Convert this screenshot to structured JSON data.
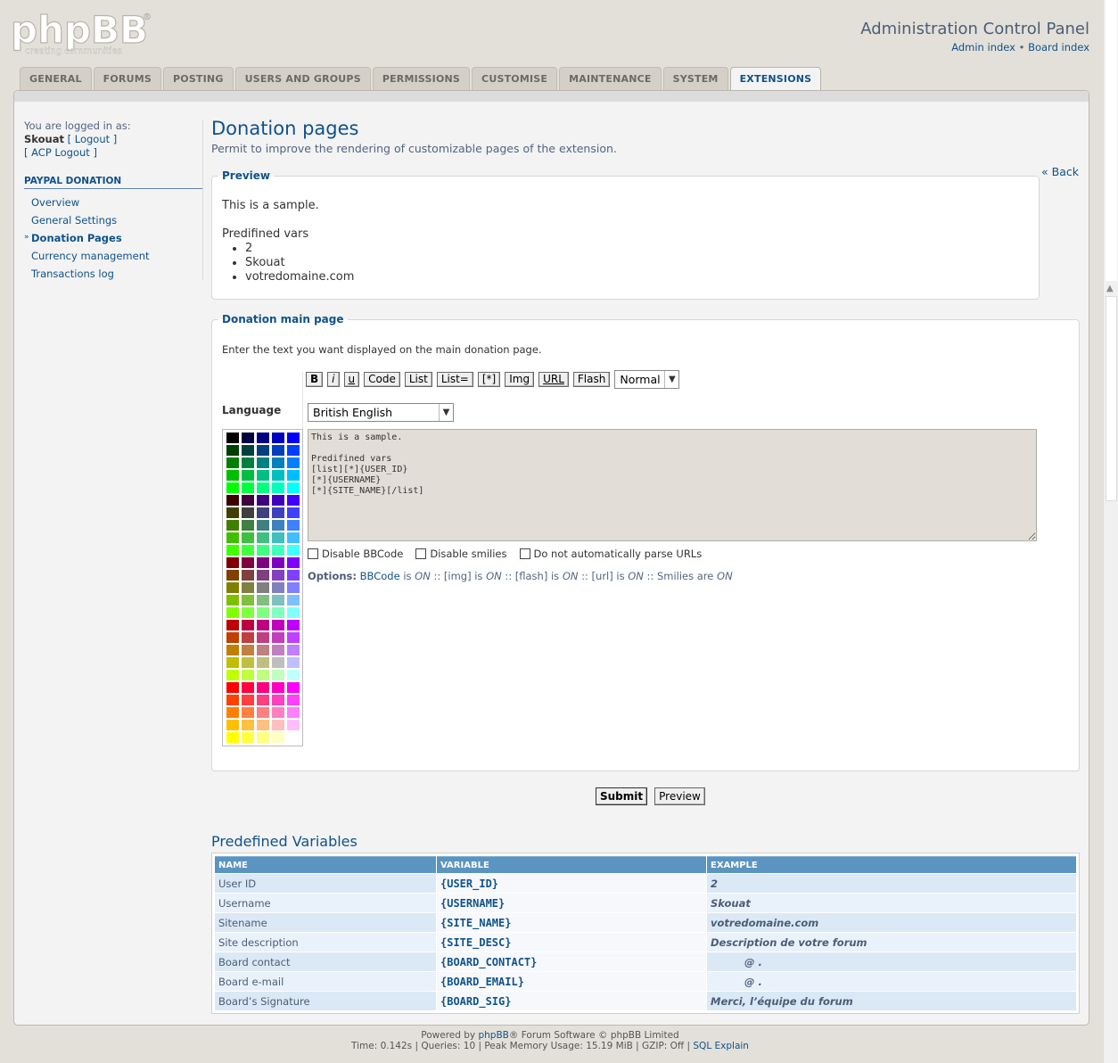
{
  "header": {
    "logo_text": "phpBB",
    "logo_tagline": "creating communities",
    "title": "Administration Control Panel",
    "admin_index": "Admin index",
    "separator": "•",
    "board_index": "Board index"
  },
  "tabs": [
    {
      "label": "GENERAL"
    },
    {
      "label": "FORUMS"
    },
    {
      "label": "POSTING"
    },
    {
      "label": "USERS AND GROUPS"
    },
    {
      "label": "PERMISSIONS"
    },
    {
      "label": "CUSTOMISE"
    },
    {
      "label": "MAINTENANCE"
    },
    {
      "label": "SYSTEM"
    },
    {
      "label": "EXTENSIONS",
      "active": true
    }
  ],
  "sidebar": {
    "logged_in_as": "You are logged in as:",
    "username": "Skouat",
    "logout": "[ Logout ]",
    "acp_logout": "[ ACP Logout ]",
    "section": "PAYPAL DONATION",
    "items": [
      {
        "label": "Overview"
      },
      {
        "label": "General Settings"
      },
      {
        "label": "Donation Pages",
        "active": true
      },
      {
        "label": "Currency management"
      },
      {
        "label": "Transactions log"
      }
    ]
  },
  "page": {
    "title": "Donation pages",
    "description": "Permit to improve the rendering of customizable pages of the extension.",
    "back": "« Back"
  },
  "preview": {
    "legend": "Preview",
    "line1": "This is a sample.",
    "line2": "Predifined vars",
    "items": [
      "2",
      "Skouat",
      "votredomaine.com"
    ]
  },
  "donation_main": {
    "legend": "Donation main page",
    "description": "Enter the text you want displayed on the main donation page.",
    "bbcode_buttons": [
      "B",
      "i",
      "u",
      "Code",
      "List",
      "List=",
      "[*]",
      "Img",
      "URL",
      "Flash"
    ],
    "font_size_selected": "Normal",
    "language_label": "Language",
    "language_selected": "British English",
    "textarea": "This is a sample.\n\nPredifined vars\n[list][*]{USER_ID}\n[*]{USERNAME}\n[*]{SITE_NAME}[/list]",
    "disable_bbcode": "Disable BBCode",
    "disable_smilies": "Disable smilies",
    "no_parse_urls": "Do not automatically parse URLs",
    "options_label": "Options:",
    "opt_bbcode": "BBCode",
    "opt_is": "is",
    "on": "ON",
    "opt_img": "[img]",
    "opt_flash": "[flash]",
    "opt_url": "[url]",
    "opt_smilies": "Smilies are",
    "opt_sep": "::"
  },
  "buttons": {
    "submit": "Submit",
    "preview": "Preview"
  },
  "vars": {
    "title": "Predefined Variables",
    "headers": [
      "NAME",
      "VARIABLE",
      "EXAMPLE"
    ],
    "rows": [
      [
        "User ID",
        "{USER_ID}",
        "2"
      ],
      [
        "Username",
        "{USERNAME}",
        "Skouat"
      ],
      [
        "Sitename",
        "{SITE_NAME}",
        "votredomaine.com"
      ],
      [
        "Site description",
        "{SITE_DESC}",
        "Description de votre forum"
      ],
      [
        "Board contact",
        "{BOARD_CONTACT}",
        "@ ."
      ],
      [
        "Board e-mail",
        "{BOARD_EMAIL}",
        "@ ."
      ],
      [
        "Board’s Signature",
        "{BOARD_SIG}",
        "Merci, l’équipe du forum"
      ]
    ]
  },
  "footer": {
    "powered_prefix": "Powered by",
    "phpbb": "phpBB",
    "powered_suffix": "® Forum Software © phpBB Limited",
    "stats": "Time: 0.142s | Queries: 10 | Peak Memory Usage: 15.19 MiB | GZIP: Off |",
    "sql_explain": "SQL Explain"
  },
  "colors": {
    "accent": "#105289",
    "table_header": "#5b94c0",
    "textarea_bg": "#e2ded7"
  }
}
